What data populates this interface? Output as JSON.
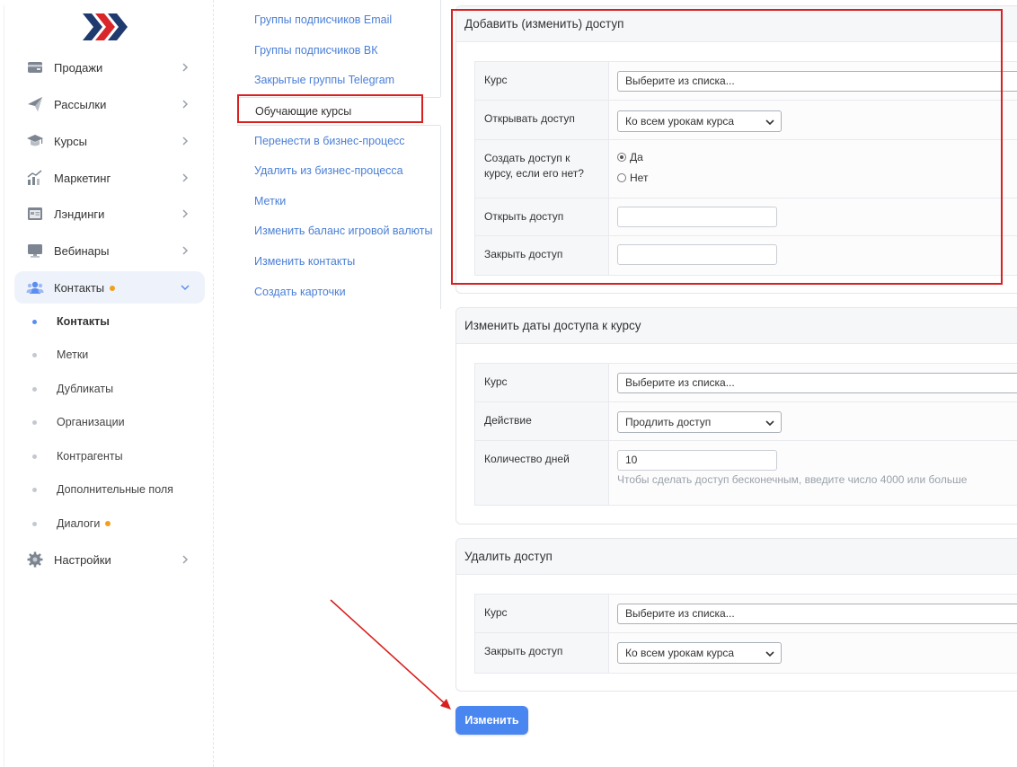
{
  "sidebar": {
    "items": [
      {
        "label": "Продажи",
        "icon": "wallet-icon"
      },
      {
        "label": "Рассылки",
        "icon": "paper-plane-icon"
      },
      {
        "label": "Курсы",
        "icon": "graduation-cap-icon"
      },
      {
        "label": "Маркетинг",
        "icon": "growth-chart-icon"
      },
      {
        "label": "Лэндинги",
        "icon": "landing-page-icon"
      },
      {
        "label": "Вебинары",
        "icon": "monitor-icon"
      },
      {
        "label": "Контакты",
        "icon": "users-icon",
        "active": true,
        "badge": true
      },
      {
        "label": "Настройки",
        "icon": "gear-icon"
      }
    ],
    "subitems": [
      {
        "label": "Контакты",
        "active": true
      },
      {
        "label": "Метки"
      },
      {
        "label": "Дубликаты"
      },
      {
        "label": "Организации"
      },
      {
        "label": "Контрагенты"
      },
      {
        "label": "Дополнительные поля"
      },
      {
        "label": "Диалоги",
        "badge": true
      }
    ],
    "accent": "#5b8def",
    "badge_color": "#f0a01c"
  },
  "actions": {
    "links": [
      "Группы подписчиков Email",
      "Группы подписчиков ВК",
      "Закрытые группы Telegram",
      "Обучающие курсы",
      "Перенести в бизнес-процесс",
      "Удалить из бизнес-процесса",
      "Метки",
      "Изменить баланс игровой валюты",
      "Изменить контакты",
      "Создать карточки"
    ],
    "active_index": 3
  },
  "add_access": {
    "title": "Добавить (изменить) доступ",
    "course_label": "Курс",
    "course_value": "Выберите из списка...",
    "open_label": "Открывать доступ",
    "open_value": "Ко всем урокам курса",
    "create_label": "Создать доступ к курсу, если его нет?",
    "yes": "Да",
    "no": "Нет",
    "yes_checked": true,
    "open_date_label": "Открыть доступ",
    "open_date_value": "",
    "close_date_label": "Закрыть доступ",
    "close_date_value": ""
  },
  "change_dates": {
    "title": "Изменить даты доступа к курсу",
    "course_label": "Курс",
    "course_value": "Выберите из списка...",
    "action_label": "Действие",
    "action_value": "Продлить доступ",
    "days_label": "Количество дней",
    "days_value": "10",
    "days_hint": "Чтобы сделать доступ бесконечным, введите число 4000 или больше"
  },
  "remove_access": {
    "title": "Удалить доступ",
    "course_label": "Курс",
    "course_value": "Выберите из списка...",
    "close_label": "Закрыть доступ",
    "close_value": "Ко всем урокам курса"
  },
  "submit_label": "Изменить",
  "colors": {
    "link": "#4a7fd6",
    "button": "#4a86f0",
    "annotation": "#d9201f"
  }
}
